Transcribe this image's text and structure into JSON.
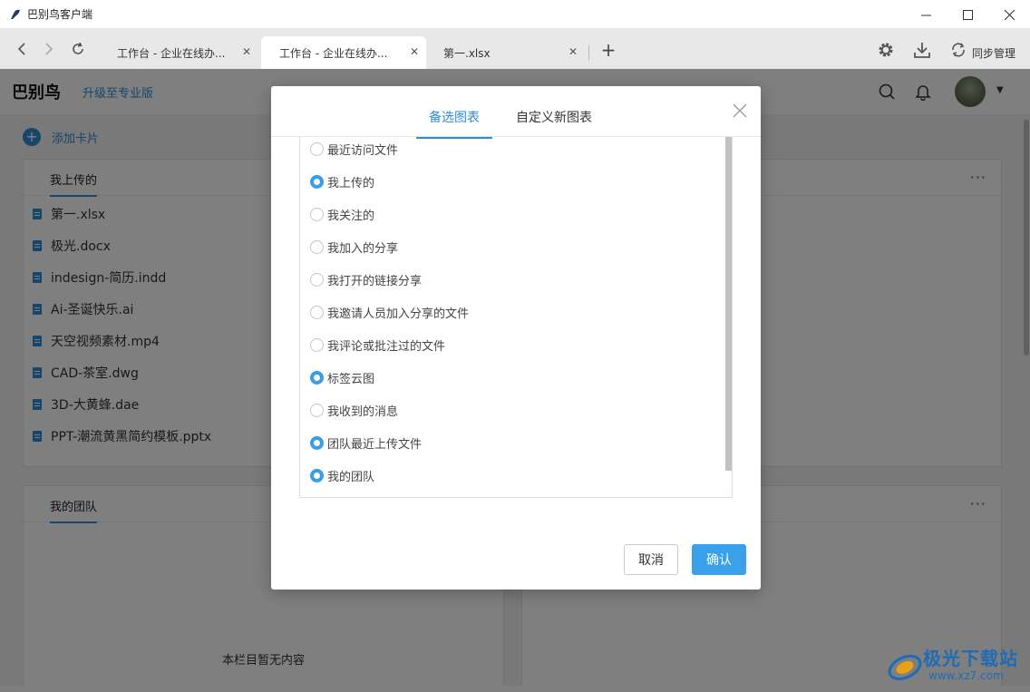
{
  "window": {
    "title": "巴别鸟客户端",
    "controls": {
      "minimize": "—",
      "maximize": "☐",
      "close": "✕"
    }
  },
  "browser": {
    "tabs": [
      {
        "label": "工作台 - 企业在线办...",
        "active": false
      },
      {
        "label": "工作台 - 企业在线办...",
        "active": true
      },
      {
        "label": "第一.xlsx",
        "active": false
      }
    ],
    "new_tab": "+",
    "sync_label": "同步管理"
  },
  "header": {
    "brand": "巴别鸟",
    "upgrade_link": "升级至专业版"
  },
  "main": {
    "add_card": "添加卡片",
    "uploaded_card": {
      "title": "我上传的",
      "files": [
        "第一.xlsx",
        "极光.docx",
        "indesign-简历.indd",
        "Ai-圣诞快乐.ai",
        "天空视频素材.mp4",
        "CAD-茶室.dwg",
        "3D-大黄蜂.dae",
        "PPT-潮流黄黑简约模板.pptx"
      ]
    },
    "team_card": {
      "title": "我的团队",
      "empty_note": "本栏目暂无内容"
    },
    "more": "···"
  },
  "dialog": {
    "tabs": [
      {
        "label": "备选图表",
        "active": true
      },
      {
        "label": "自定义新图表",
        "active": false
      }
    ],
    "options": [
      {
        "label": "最近访问文件",
        "checked": false
      },
      {
        "label": "我上传的",
        "checked": true
      },
      {
        "label": "我关注的",
        "checked": false
      },
      {
        "label": "我加入的分享",
        "checked": false
      },
      {
        "label": "我打开的链接分享",
        "checked": false
      },
      {
        "label": "我邀请人员加入分享的文件",
        "checked": false
      },
      {
        "label": "我评论或批注过的文件",
        "checked": false
      },
      {
        "label": "标签云图",
        "checked": true
      },
      {
        "label": "我收到的消息",
        "checked": false
      },
      {
        "label": "团队最近上传文件",
        "checked": true
      },
      {
        "label": "我的团队",
        "checked": true
      }
    ],
    "cancel": "取消",
    "confirm": "确认"
  },
  "watermark": {
    "name": "极光下载站",
    "url": "www.xz7.com"
  },
  "colors": {
    "accent": "#2f8cd6",
    "confirm_button": "#3aa0ea",
    "overlay": "rgba(0,0,0,0.5)"
  }
}
